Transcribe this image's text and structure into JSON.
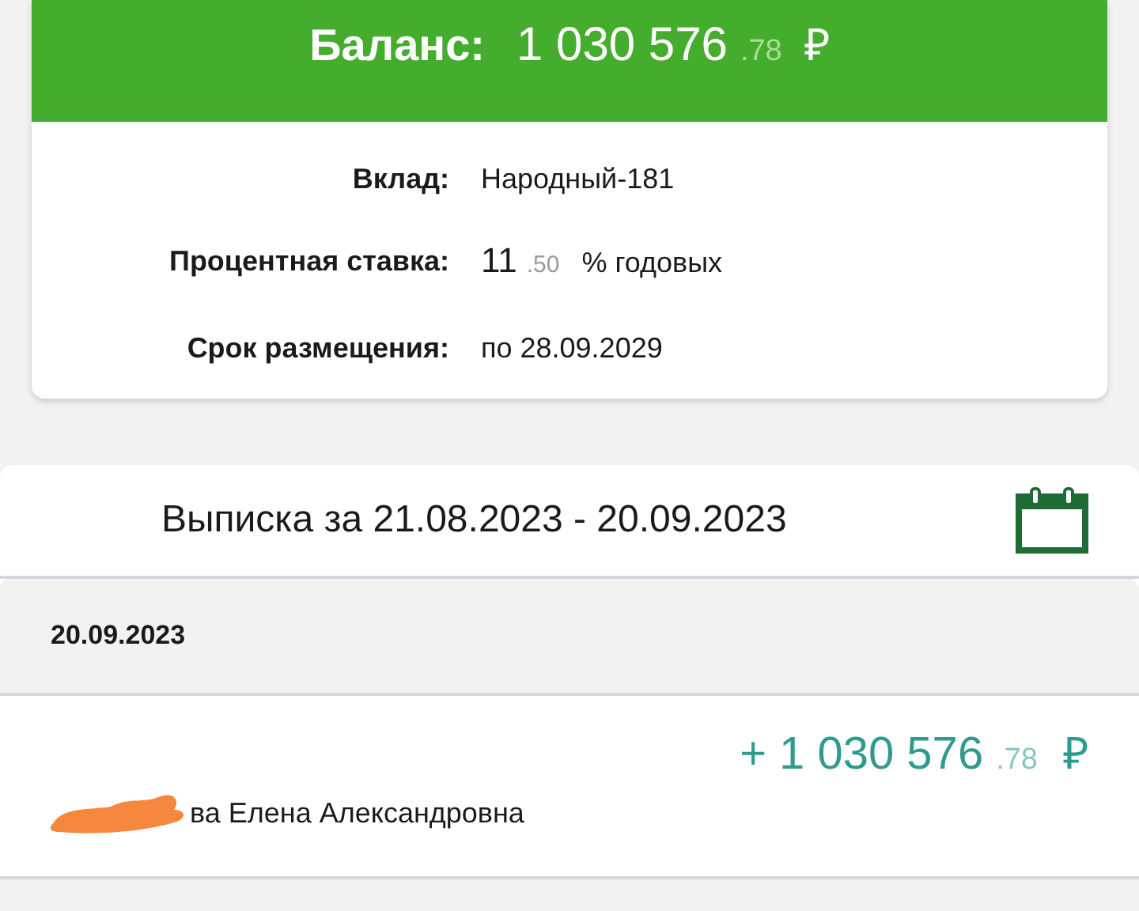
{
  "balance": {
    "label": "Баланс:",
    "integer": "1 030 576",
    "fraction": ".78",
    "currency": "₽"
  },
  "details": [
    {
      "kind": "text",
      "label": "Вклад:",
      "value": "Народный-181"
    },
    {
      "kind": "rate",
      "label": "Процентная ставка:",
      "value": "11",
      "fraction": ".50",
      "suffix": "% годовых"
    },
    {
      "kind": "text",
      "label": "Срок размещения:",
      "value": "по 28.09.2029"
    }
  ],
  "statement": {
    "title": "Выписка за 21.08.2023 - 20.09.2023"
  },
  "groups": [
    {
      "date": "20.09.2023",
      "transactions": [
        {
          "sign": "+",
          "integer": "1 030 576",
          "fraction": ".78",
          "currency": "₽",
          "name": "ва Елена Александровна",
          "redacted": true
        }
      ]
    }
  ]
}
